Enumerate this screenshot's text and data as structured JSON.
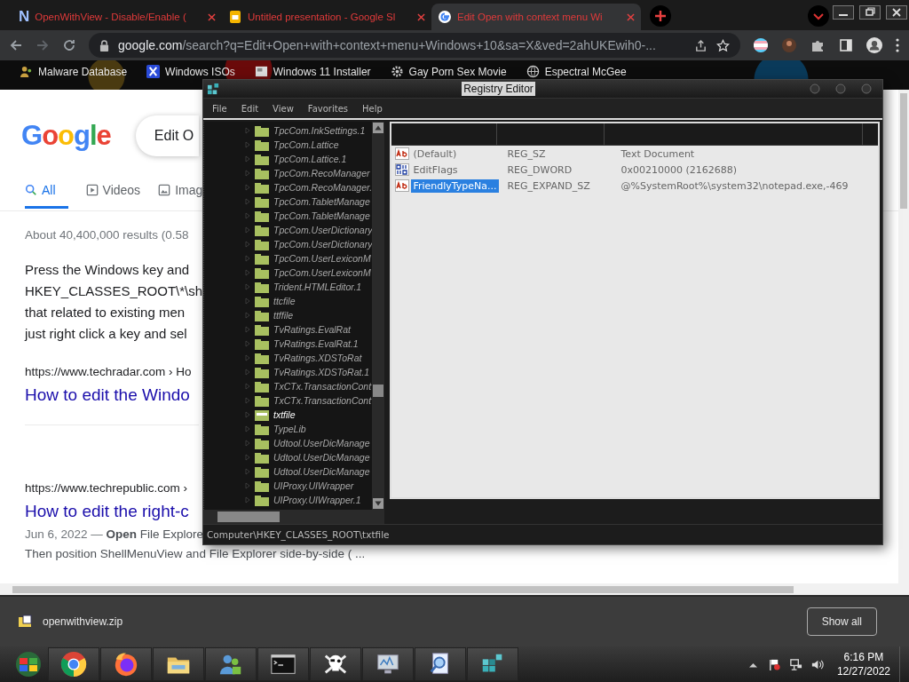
{
  "browser": {
    "tabs": [
      {
        "label": "OpenWithView - Disable/Enable (",
        "selected": false,
        "kind": "letter",
        "badge": "N"
      },
      {
        "label": "Untitled presentation - Google Sl",
        "selected": false,
        "kind": "slides"
      },
      {
        "label": "Edit Open with context menu Wi",
        "selected": true,
        "kind": "google"
      }
    ],
    "address": {
      "host": "google.com",
      "path": "/search?q=Edit+Open+with+context+menu+Windows+10&sa=X&ved=2ahUKEwih0-..."
    },
    "bookmarks": [
      {
        "label": "Malware Database",
        "kind": "people"
      },
      {
        "label": "Windows ISOs",
        "kind": "x"
      },
      {
        "label": "Windows 11 Installer",
        "kind": "page"
      },
      {
        "label": "Gay Porn Sex Movie",
        "kind": "gear"
      },
      {
        "label": "Espectral McGee",
        "kind": "globe"
      }
    ]
  },
  "google": {
    "logo": "Google",
    "query": "Edit O",
    "tabs": [
      {
        "label": "All",
        "selected": true,
        "kind": "search"
      },
      {
        "label": "Videos",
        "selected": false,
        "kind": "video"
      },
      {
        "label": "Imag",
        "selected": false,
        "kind": "image"
      }
    ],
    "stats": "About 40,400,000 results (0.58",
    "snippet": [
      "Press the Windows key and",
      "HKEY_CLASSES_ROOT\\*\\sh",
      "that related to existing men",
      "just right click a key and sel"
    ],
    "results": [
      {
        "url": "https://www.techradar.com › Ho",
        "title": "How to edit the Windo"
      },
      {
        "url": "https://www.techrepublic.com ›",
        "title": "How to edit the right-c",
        "date": "Jun 6, 2022 — ",
        "text": "**Open** File Explore",
        "more": "Then position ShellMenuView and File Explorer side-by-side ( ..."
      }
    ]
  },
  "registry": {
    "title": "Registry Editor",
    "menu": [
      "File",
      "Edit",
      "View",
      "Favorites",
      "Help"
    ],
    "tree": [
      {
        "label": "TpcCom.InkSettings.1",
        "selected": false
      },
      {
        "label": "TpcCom.Lattice",
        "selected": false
      },
      {
        "label": "TpcCom.Lattice.1",
        "selected": false
      },
      {
        "label": "TpcCom.RecoManager",
        "selected": false
      },
      {
        "label": "TpcCom.RecoManager.",
        "selected": false
      },
      {
        "label": "TpcCom.TabletManage",
        "selected": false
      },
      {
        "label": "TpcCom.TabletManage",
        "selected": false
      },
      {
        "label": "TpcCom.UserDictionary",
        "selected": false
      },
      {
        "label": "TpcCom.UserDictionary",
        "selected": false
      },
      {
        "label": "TpcCom.UserLexiconM",
        "selected": false
      },
      {
        "label": "TpcCom.UserLexiconM",
        "selected": false
      },
      {
        "label": "Trident.HTMLEditor.1",
        "selected": false
      },
      {
        "label": "ttcfile",
        "selected": false
      },
      {
        "label": "ttffile",
        "selected": false
      },
      {
        "label": "TvRatings.EvalRat",
        "selected": false
      },
      {
        "label": "TvRatings.EvalRat.1",
        "selected": false
      },
      {
        "label": "TvRatings.XDSToRat",
        "selected": false
      },
      {
        "label": "TvRatings.XDSToRat.1",
        "selected": false
      },
      {
        "label": "TxCTx.TransactionCont",
        "selected": false
      },
      {
        "label": "TxCTx.TransactionCont",
        "selected": false
      },
      {
        "label": "txtfile",
        "selected": true
      },
      {
        "label": "TypeLib",
        "selected": false
      },
      {
        "label": "Udtool.UserDicManage",
        "selected": false
      },
      {
        "label": "Udtool.UserDicManage",
        "selected": false
      },
      {
        "label": "Udtool.UserDicManage",
        "selected": false
      },
      {
        "label": "UIProxy.UIWrapper",
        "selected": false
      },
      {
        "label": "UIProxy.UIWrapper.1",
        "selected": false
      }
    ],
    "values": [
      {
        "name": "(Default)",
        "type": "REG_SZ",
        "data": "Text Document",
        "kind": "string",
        "selected": false
      },
      {
        "name": "EditFlags",
        "type": "REG_DWORD",
        "data": "0x00210000 (2162688)",
        "kind": "binary",
        "selected": false
      },
      {
        "name": "FriendlyTypeNa...",
        "type": "REG_EXPAND_SZ",
        "data": "@%SystemRoot%\\system32\\notepad.exe,-469",
        "kind": "string",
        "selected": true
      }
    ],
    "status": "Computer\\HKEY_CLASSES_ROOT\\txtfile"
  },
  "downloads": {
    "file": "openwithview.zip",
    "button": "Show all"
  },
  "taskbar": {
    "apps": [
      {
        "kind": "chrome"
      },
      {
        "kind": "fox"
      },
      {
        "kind": "folder"
      },
      {
        "kind": "people"
      },
      {
        "kind": "terminal"
      },
      {
        "kind": "skull"
      },
      {
        "kind": "monitor"
      },
      {
        "kind": "magnifier"
      },
      {
        "kind": "cubes"
      }
    ],
    "time": "6:16 PM",
    "date": "12/27/2022"
  }
}
